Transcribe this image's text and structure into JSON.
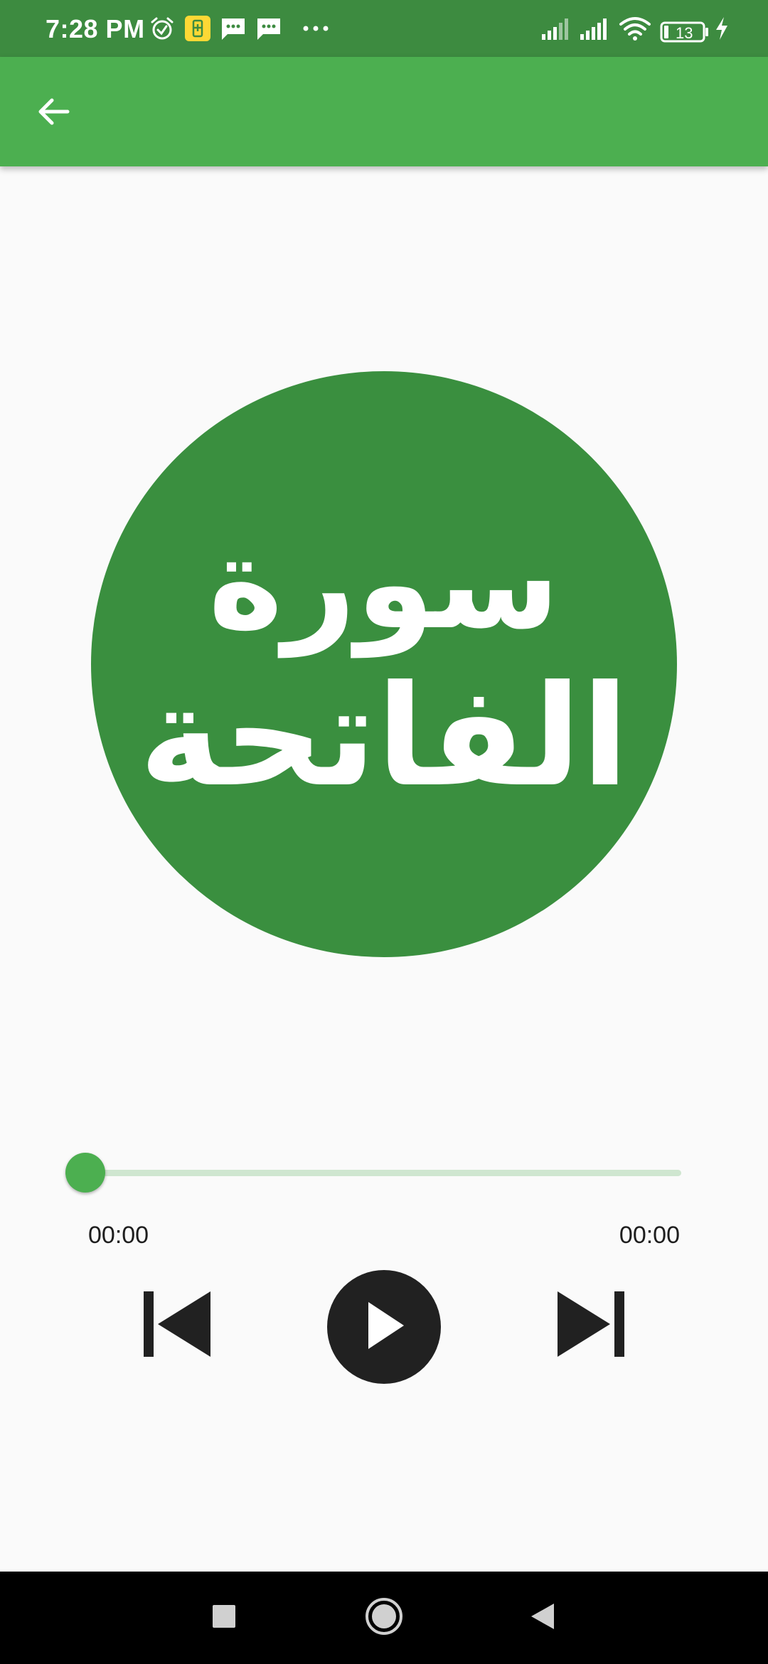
{
  "status_bar": {
    "time": "7:28 PM",
    "battery_level": "13",
    "background_color": "#3d8b40",
    "icons": [
      "alarm-icon",
      "battery-saver-icon",
      "message-icon",
      "message-icon",
      "more-dots-icon",
      "signal-icon",
      "signal-icon",
      "wifi-icon",
      "battery-icon",
      "charging-icon"
    ]
  },
  "app_bar": {
    "background_color": "#4caf50",
    "back_icon": "arrow-left-icon"
  },
  "cover": {
    "line_1": "سورة",
    "line_2": "الفاتحة",
    "background_color": "#3a8f3f"
  },
  "player": {
    "progress": 0,
    "elapsed": "00:00",
    "total": "00:00",
    "accent_color": "#4caf50",
    "controls": [
      "skip-previous-icon",
      "play-icon",
      "skip-next-icon"
    ]
  },
  "nav_bar": {
    "buttons": [
      "recents-square-icon",
      "home-circle-icon",
      "back-triangle-icon"
    ]
  }
}
